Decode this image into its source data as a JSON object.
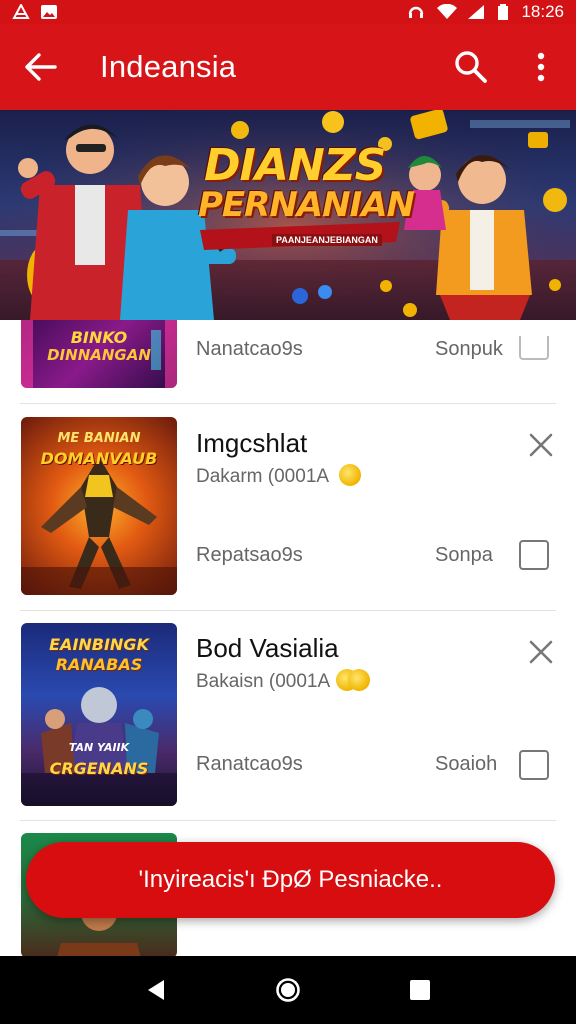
{
  "status_bar": {
    "time": "18:26",
    "left_icons": [
      "notification-icon",
      "image-icon"
    ],
    "right_icons": [
      "headset-icon",
      "wifi-icon",
      "signal-icon",
      "battery-icon"
    ]
  },
  "app_bar": {
    "title": "Indeansia",
    "back_icon": "arrow-left-icon",
    "actions": [
      "search-icon",
      "more-vert-icon"
    ]
  },
  "banner": {
    "title_line1": "DIANZS",
    "title_line2": "PERNANIAN",
    "subtitle": "PAANJEANJEBIANGAN"
  },
  "list": {
    "items": [
      {
        "thumb_text_1": "BINKO",
        "thumb_text_2": "DINNANGAN",
        "left_label": "Nanatcao9s",
        "right_label": "Sonpuk",
        "checked": false
      },
      {
        "thumb_text_1": "ME BANIAN",
        "thumb_text_2": "DOMANVAUB",
        "title": "Imgcshlat",
        "subtitle": "Dakarm (0001A",
        "left_label": "Repatsao9s",
        "right_label": "Sonpa",
        "checked": false,
        "close_icon": "close-icon"
      },
      {
        "thumb_text_1": "EAINBINGK",
        "thumb_text_2": "RANABAS",
        "thumb_text_3": "TAN YAIIK",
        "thumb_text_4": "CRGENANS",
        "title": "Bod Vasialia",
        "subtitle": "Bakaisn (0001A",
        "left_label": "Ranatcao9s",
        "right_label": "Soaioh",
        "checked": false,
        "close_icon": "close-icon"
      }
    ]
  },
  "snackbar": {
    "text": "'Inyireacis'ı ÐpØ Pesniacke.."
  },
  "nav_bar": {
    "buttons": [
      "back-triangle-icon",
      "home-circle-icon",
      "recents-square-icon"
    ]
  },
  "colors": {
    "primary": "#d71519",
    "snackbar": "#d70d0f"
  }
}
